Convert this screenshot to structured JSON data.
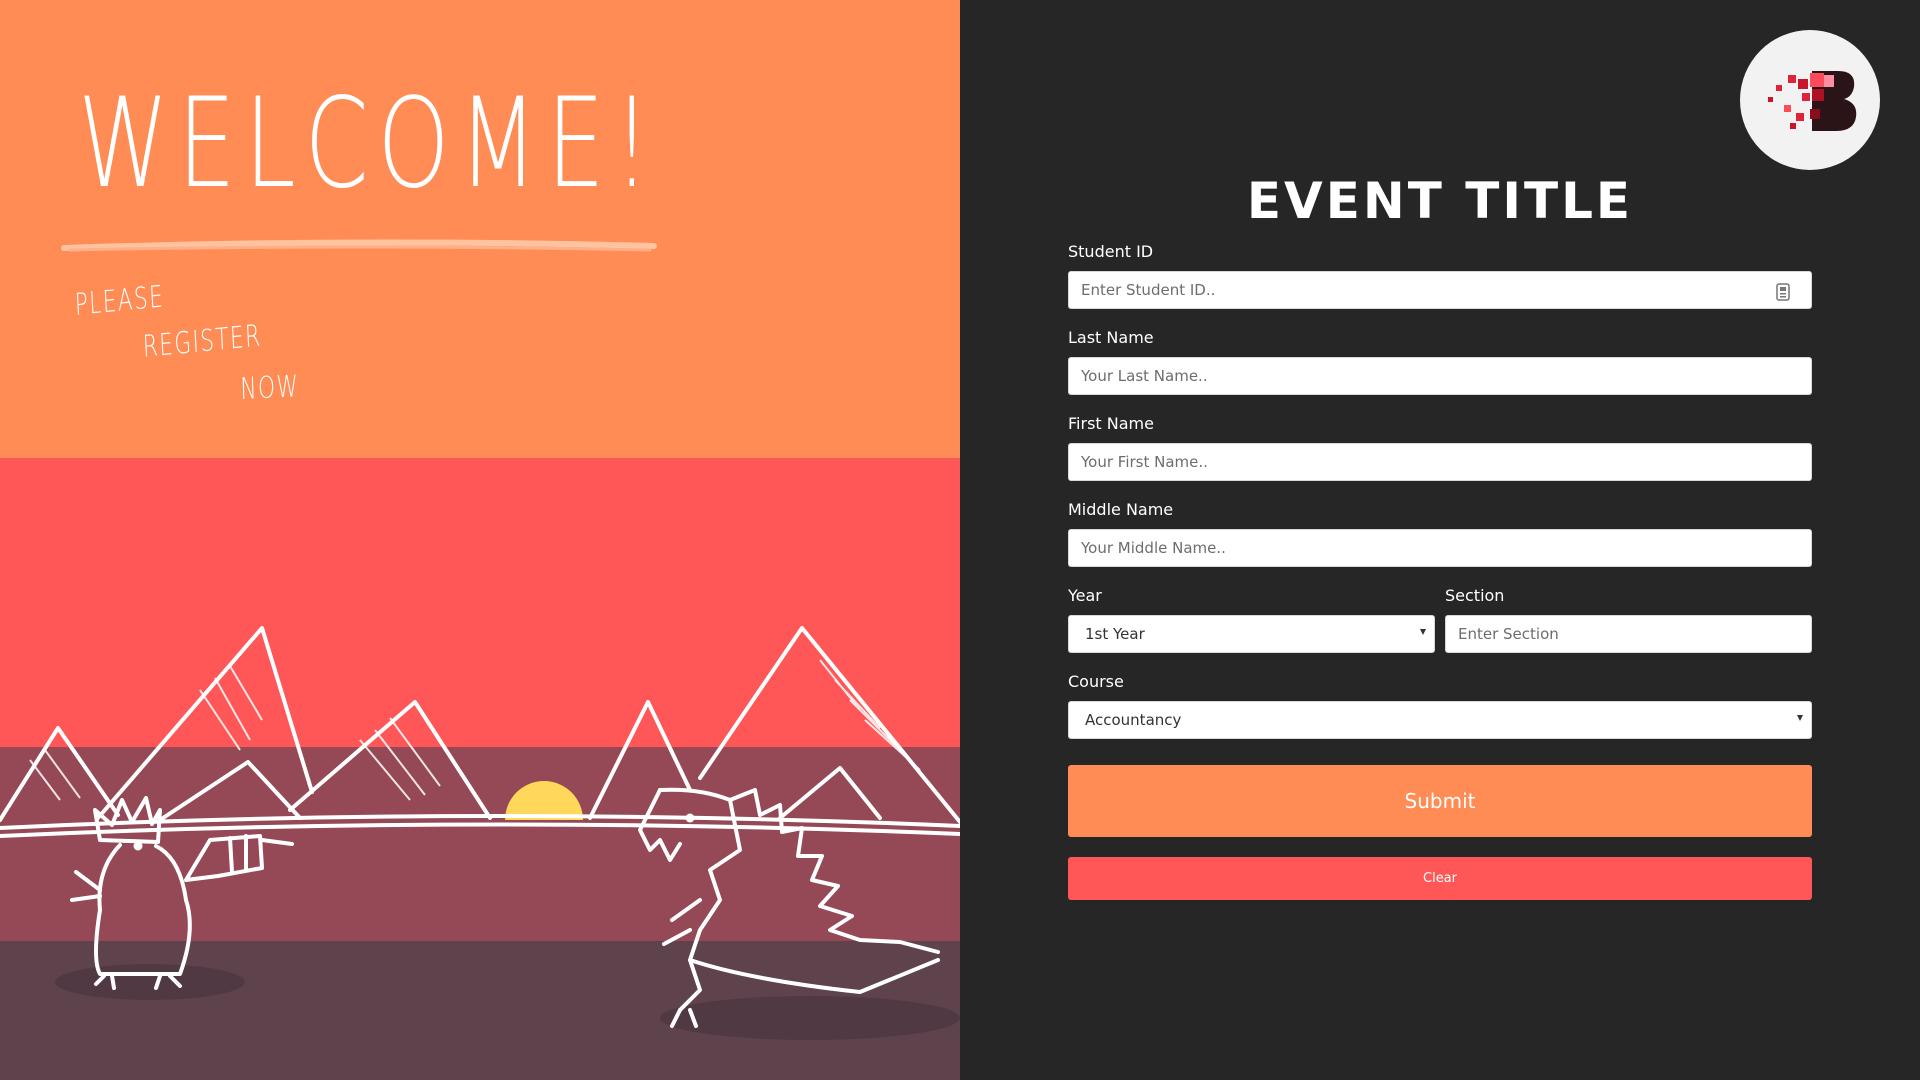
{
  "left": {
    "welcome": "WELCOME!",
    "tagline": [
      "PLEASE",
      "REGISTER",
      "NOW"
    ]
  },
  "form": {
    "title": "EVENT TITLE",
    "student_id": {
      "label": "Student ID",
      "placeholder": "Enter Student ID..",
      "value": ""
    },
    "last_name": {
      "label": "Last Name",
      "placeholder": "Your Last Name..",
      "value": ""
    },
    "first_name": {
      "label": "First Name",
      "placeholder": "Your First Name..",
      "value": ""
    },
    "middle_name": {
      "label": "Middle Name",
      "placeholder": "Your Middle Name..",
      "value": ""
    },
    "year": {
      "label": "Year",
      "selected": "1st Year"
    },
    "section": {
      "label": "Section",
      "placeholder": "Enter Section",
      "value": ""
    },
    "course": {
      "label": "Course",
      "selected": "Accountancy"
    },
    "submit_label": "Submit",
    "clear_label": "Clear"
  },
  "colors": {
    "orange": "#ff8c55",
    "red": "#ff5757",
    "mauve": "#954957",
    "dark_mauve": "#5e434d",
    "panel_bg": "#262626",
    "sun": "#ffd75a"
  },
  "icons": {
    "logo": "pixel-b-logo-icon",
    "student_id_field": "id-card-icon",
    "select_caret": "caret-down-icon"
  }
}
